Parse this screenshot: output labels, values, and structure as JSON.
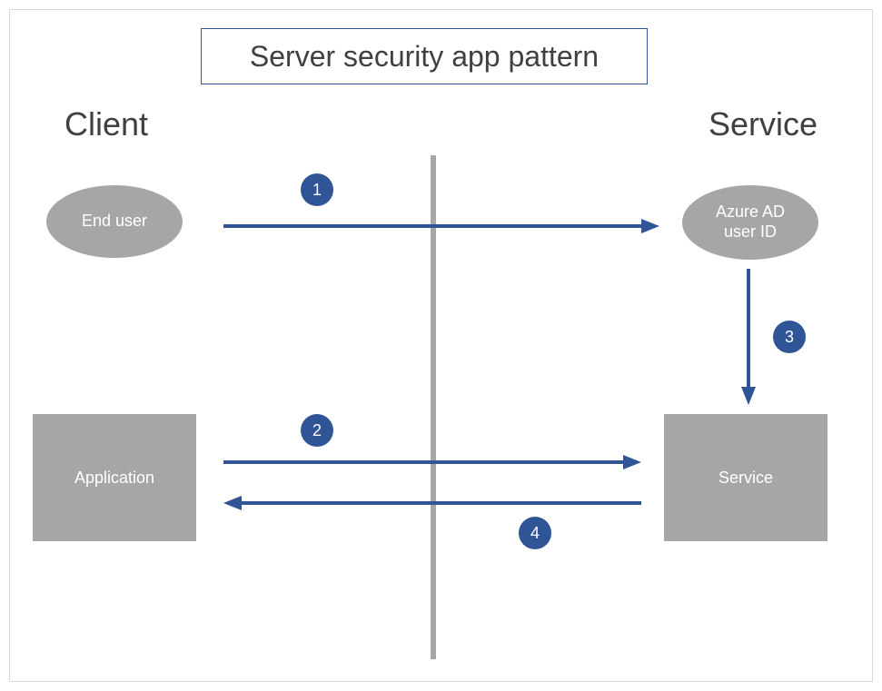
{
  "title": "Server security app pattern",
  "headings": {
    "client": "Client",
    "service": "Service"
  },
  "nodes": {
    "end_user": "End user",
    "azure_ad": "Azure AD\nuser ID",
    "application": "Application",
    "service_box": "Service"
  },
  "steps": {
    "one": "1",
    "two": "2",
    "three": "3",
    "four": "4"
  }
}
